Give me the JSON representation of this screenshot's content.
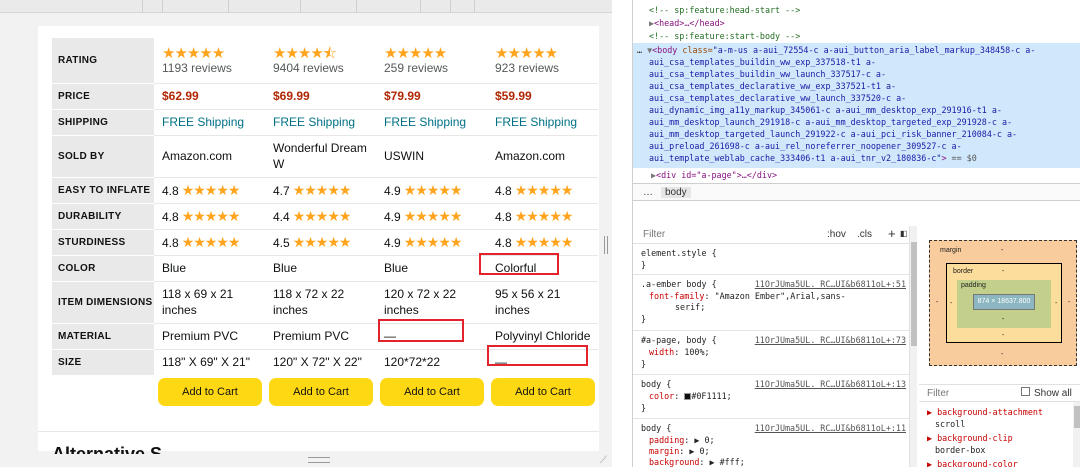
{
  "comparison": {
    "rows": [
      {
        "label": "RATING"
      },
      {
        "label": "PRICE"
      },
      {
        "label": "SHIPPING"
      },
      {
        "label": "SOLD BY"
      },
      {
        "label": "EASY TO INFLATE"
      },
      {
        "label": "DURABILITY"
      },
      {
        "label": "STURDINESS"
      },
      {
        "label": "COLOR"
      },
      {
        "label": "ITEM DIMENSIONS"
      },
      {
        "label": "MATERIAL"
      },
      {
        "label": "SIZE"
      }
    ],
    "products": [
      {
        "stars": "★★★★★",
        "reviews": "1193 reviews",
        "price": "$62.99",
        "shipping": "FREE Shipping",
        "sold_by": "Amazon.com",
        "easy_inflate": "4.8",
        "durability": "4.8",
        "sturdiness": "4.8",
        "color": "Blue",
        "dimensions": "118 x 69 x 21 inches",
        "material": "Premium PVC",
        "size": "118\" X 69\" X 21\"",
        "cart": "Add to Cart"
      },
      {
        "stars": "★★★★⯪",
        "reviews": "9404 reviews",
        "price": "$69.99",
        "shipping": "FREE Shipping",
        "sold_by": "Wonderful Dream W",
        "easy_inflate": "4.7",
        "durability": "4.4",
        "sturdiness": "4.5",
        "color": "Blue",
        "dimensions": "118 x 72 x 22 inches",
        "material": "Premium PVC",
        "size": "120\" X 72\" X 22\"",
        "cart": "Add to Cart"
      },
      {
        "stars": "★★★★★",
        "reviews": "259 reviews",
        "price": "$79.99",
        "shipping": "FREE Shipping",
        "sold_by": "USWIN",
        "easy_inflate": "4.9",
        "durability": "4.9",
        "sturdiness": "4.9",
        "color": "Blue",
        "dimensions": "120 x 72 x 22 inches",
        "material": "—",
        "size": "120*72*22",
        "cart": "Add to Cart"
      },
      {
        "stars": "★★★★★",
        "reviews": "923 reviews",
        "price": "$59.99",
        "shipping": "FREE Shipping",
        "sold_by": "Amazon.com",
        "easy_inflate": "4.8",
        "durability": "4.8",
        "sturdiness": "4.8",
        "color": "Colorful",
        "dimensions": "95 x 56 x 21 inches",
        "material": "Polyvinyl Chloride",
        "size": "—",
        "cart": "Add to Cart"
      }
    ],
    "sub_stars": "★★★★★",
    "next_heading": "Alternative S..."
  },
  "devtools": {
    "elements_lines": {
      "l1": "<!-- sp:feature:head-start -->",
      "l2a": "<head>",
      "l2b": "…</head>",
      "l3": "<!-- sp:feature:start-body -->",
      "body_tag": "<body",
      "body_attr": "class=",
      "body_classes": [
        "\"a-m-us a-aui_72554-c a-aui_button_aria_label_markup_348458-c a-",
        "aui_csa_templates_buildin_ww_exp_337518-t1 a-",
        "aui_csa_templates_buildin_ww_launch_337517-c a-",
        "aui_csa_templates_declarative_ww_exp_337521-t1 a-",
        "aui_csa_templates_declarative_ww_launch_337520-c a-",
        "aui_dynamic_img_a11y_markup_345061-c a-aui_mm_desktop_exp_291916-t1 a-",
        "aui_mm_desktop_launch_291918-c a-aui_mm_desktop_targeted_exp_291928-c a-",
        "aui_mm_desktop_targeted_launch_291922-c a-aui_pci_risk_banner_210084-c a-",
        "aui_preload_261698-c a-aui_rel_noreferrer_noopener_309527-c a-",
        "aui_template_weblab_cache_333406-t1 a-aui_tnr_v2_180836-c\""
      ],
      "body_eq": "== $0",
      "div_line": "<div id=\"a-page\">…</div>"
    },
    "crumbs": {
      "more": "…",
      "body": "body"
    },
    "styles_toolbar": {
      "filter": "Filter",
      "hov": ":hov",
      "cls": ".cls",
      "plus": "+"
    },
    "rules": [
      {
        "sel": "element.style {",
        "props": [],
        "close": "}"
      },
      {
        "sel": ".a-ember body {",
        "src": "11OrJUma5UL._RC…UI&b6811oL+:51",
        "props": [
          {
            "n": "font-family",
            "v": "\"Amazon Ember\",Arial,sans-"
          },
          {
            "n": "",
            "v": "serif;"
          }
        ],
        "close": "}"
      },
      {
        "sel": "#a-page, body {",
        "src": "11OrJUma5UL._RC…UI&b6811oL+:73",
        "props": [
          {
            "n": "width",
            "v": "100%;"
          }
        ],
        "close": "}"
      },
      {
        "sel": "body {",
        "src": "11OrJUma5UL._RC…UI&b6811oL+:13",
        "props": [
          {
            "n": "color",
            "v": "#0F1111;"
          }
        ],
        "close": "}"
      },
      {
        "sel": "body {",
        "src": "11OrJUma5UL._RC…UI&b6811oL+:11",
        "props": [
          {
            "n": "padding",
            "v": "▶ 0;"
          },
          {
            "n": "margin",
            "v": "▶ 0;"
          },
          {
            "n": "background",
            "v": "▶ #fff;"
          }
        ],
        "close": ""
      }
    ],
    "box_model": {
      "margin": "margin",
      "border": "border",
      "padding": "padding",
      "content": "874 × 18637.800",
      "dash": "-"
    },
    "computed_toolbar": {
      "filter": "Filter",
      "show_all": "Show all"
    },
    "computed": [
      {
        "n": "background-attachment",
        "v": "scroll"
      },
      {
        "n": "background-clip",
        "v": "border-box"
      },
      {
        "n": "background-color",
        "v": ""
      }
    ],
    "colors": {
      "selection": "#cfe8fc",
      "prop": "#c80000",
      "star": "#ffa41c",
      "price": "#b12704",
      "link": "#007185",
      "cart": "#ffd814",
      "highlight": "#e2232a"
    }
  }
}
